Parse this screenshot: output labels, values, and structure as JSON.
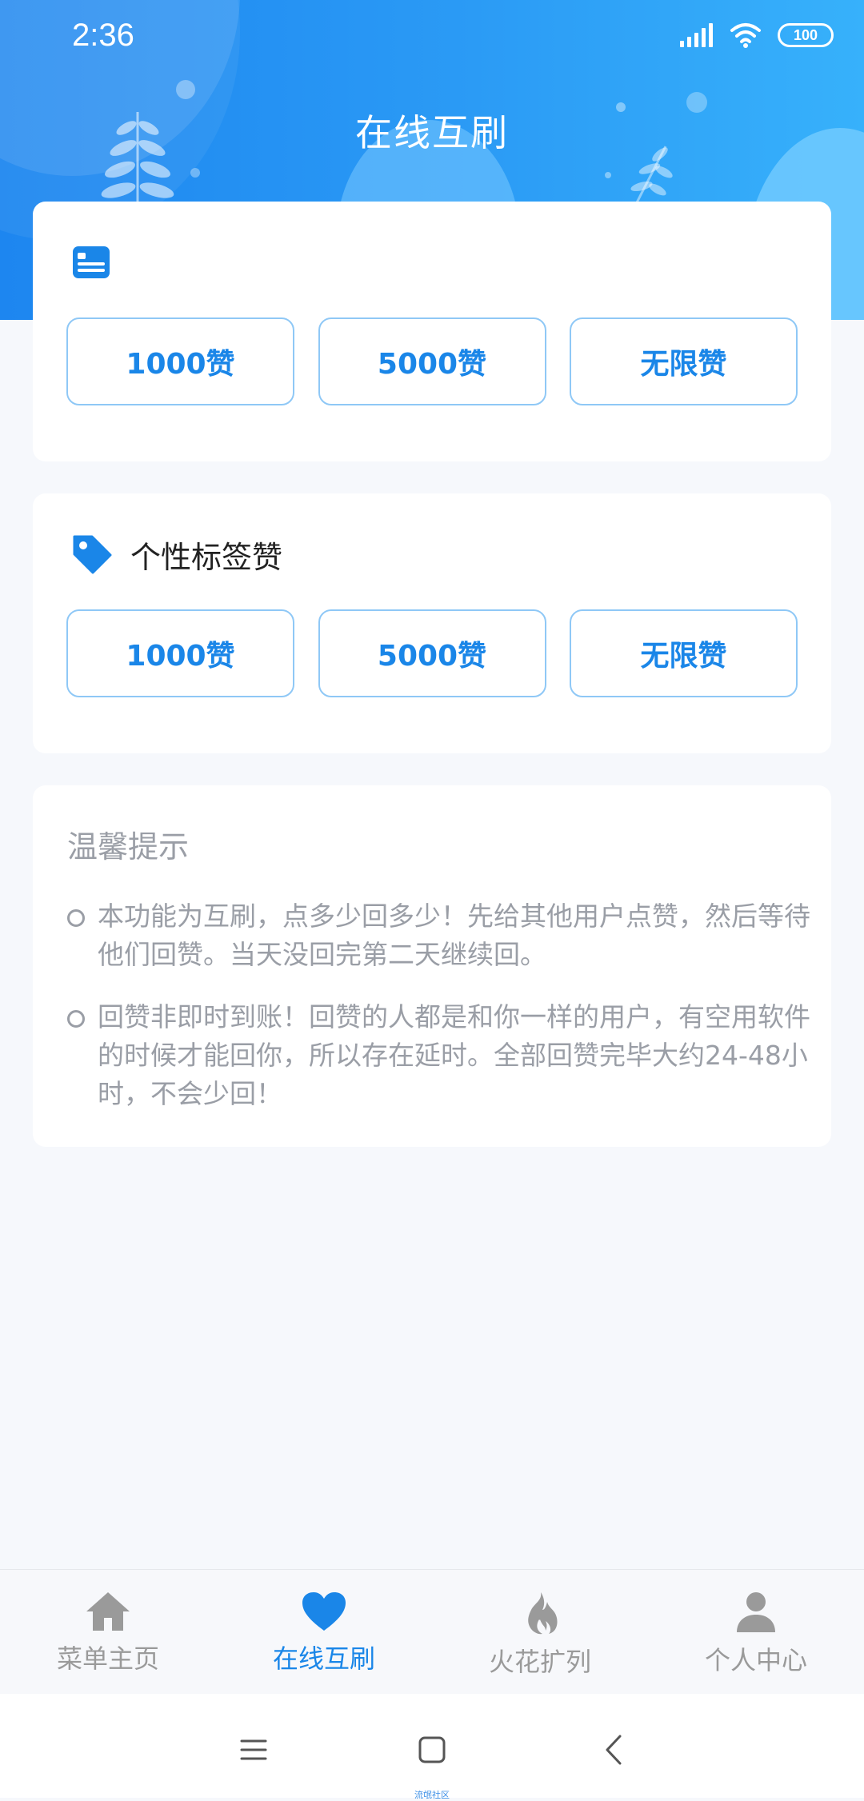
{
  "status_bar": {
    "time": "2:36",
    "battery": "100"
  },
  "header": {
    "title": "在线互刷"
  },
  "card_likes": {
    "buttons": [
      "1000赞",
      "5000赞",
      "无限赞"
    ]
  },
  "card_tag_likes": {
    "title": "个性标签赞",
    "buttons": [
      "1000赞",
      "5000赞",
      "无限赞"
    ]
  },
  "tips": {
    "title": "温馨提示",
    "items": [
      "本功能为互刷，点多少回多少！先给其他用户点赞，然后等待他们回赞。当天没回完第二天继续回。",
      "回赞非即时到账！回赞的人都是和你一样的用户，有空用软件的时候才能回你，所以存在延时。全部回赞完毕大约24-48小时，不会少回！"
    ]
  },
  "bottom_nav": {
    "items": [
      {
        "label": "菜单主页",
        "icon": "home-icon"
      },
      {
        "label": "在线互刷",
        "icon": "heart-icon"
      },
      {
        "label": "火花扩列",
        "icon": "flame-icon"
      },
      {
        "label": "个人中心",
        "icon": "person-icon"
      }
    ],
    "active_index": 1
  },
  "watermark": "流氓社区",
  "colors": {
    "accent": "#1a86e8",
    "header_start": "#1d86f0",
    "header_end": "#37b1fb",
    "muted_text": "#9a9ea6"
  }
}
